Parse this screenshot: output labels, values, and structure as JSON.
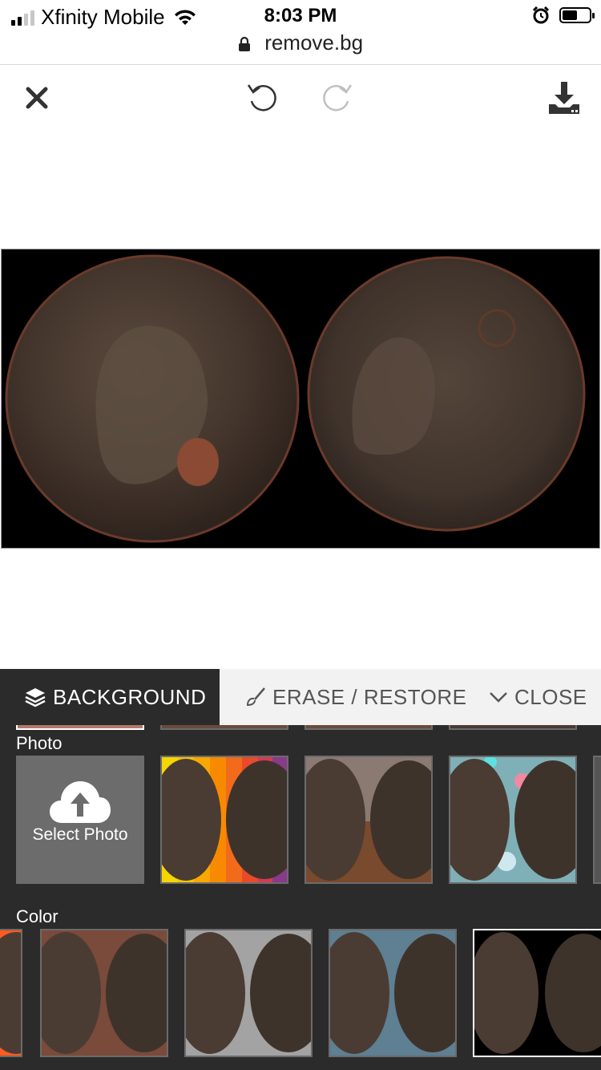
{
  "status_bar": {
    "carrier": "Xfinity Mobile",
    "time": "8:03 PM",
    "url": "remove.bg"
  },
  "toolbar": {
    "close_icon": "close-icon",
    "undo_icon": "undo-icon",
    "redo_icon": "redo-icon",
    "download_icon": "download-icon"
  },
  "panel": {
    "tabs": {
      "background": "BACKGROUND",
      "erase_restore": "ERASE / RESTORE",
      "close": "CLOSE"
    },
    "photo_label": "Photo",
    "select_photo": "Select Photo",
    "color_label": "Color",
    "photo_backgrounds": [
      "rainbow-stripes",
      "brick-and-wood",
      "bokeh-lights"
    ],
    "color_backgrounds": [
      "#ff5a1f",
      "#7a4a3a",
      "#a3a3a3",
      "#5f7f92",
      "#000000"
    ],
    "selected_color": "#000000"
  },
  "colors": {
    "panel_bg": "#2b2b2b",
    "tab_bar_bg": "#f2f2f2",
    "coin_bg": "#000000"
  }
}
